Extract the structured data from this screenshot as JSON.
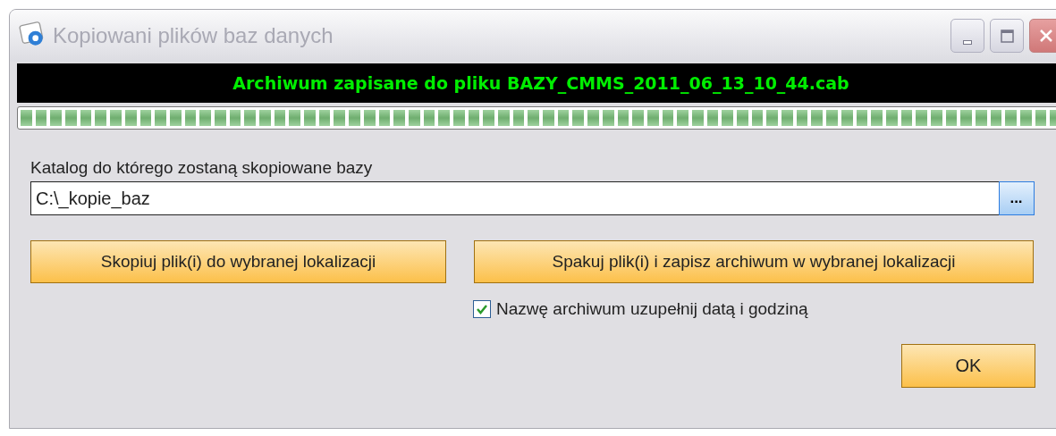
{
  "window": {
    "title": "Kopiowani plików baz danych"
  },
  "status_message": "Archiwum zapisane do pliku BAZY_CMMS_2011_06_13_10_44.cab",
  "progress": {
    "level": 1
  },
  "folder": {
    "label": "Katalog do którego zostaną skopiowane bazy",
    "value": "C:\\_kopie_baz",
    "browse_button": "..."
  },
  "buttons": [
    {
      "label": "Skopiuj plik(i) do wybranej lokalizacji"
    },
    {
      "label": "Spakuj plik(i) i zapisz archiwum w wybranej lokalizacji"
    }
  ],
  "option": {
    "label": "Nazwę archiwum uzupełnij datą i godziną",
    "checked": true
  },
  "ok_button": "OK"
}
